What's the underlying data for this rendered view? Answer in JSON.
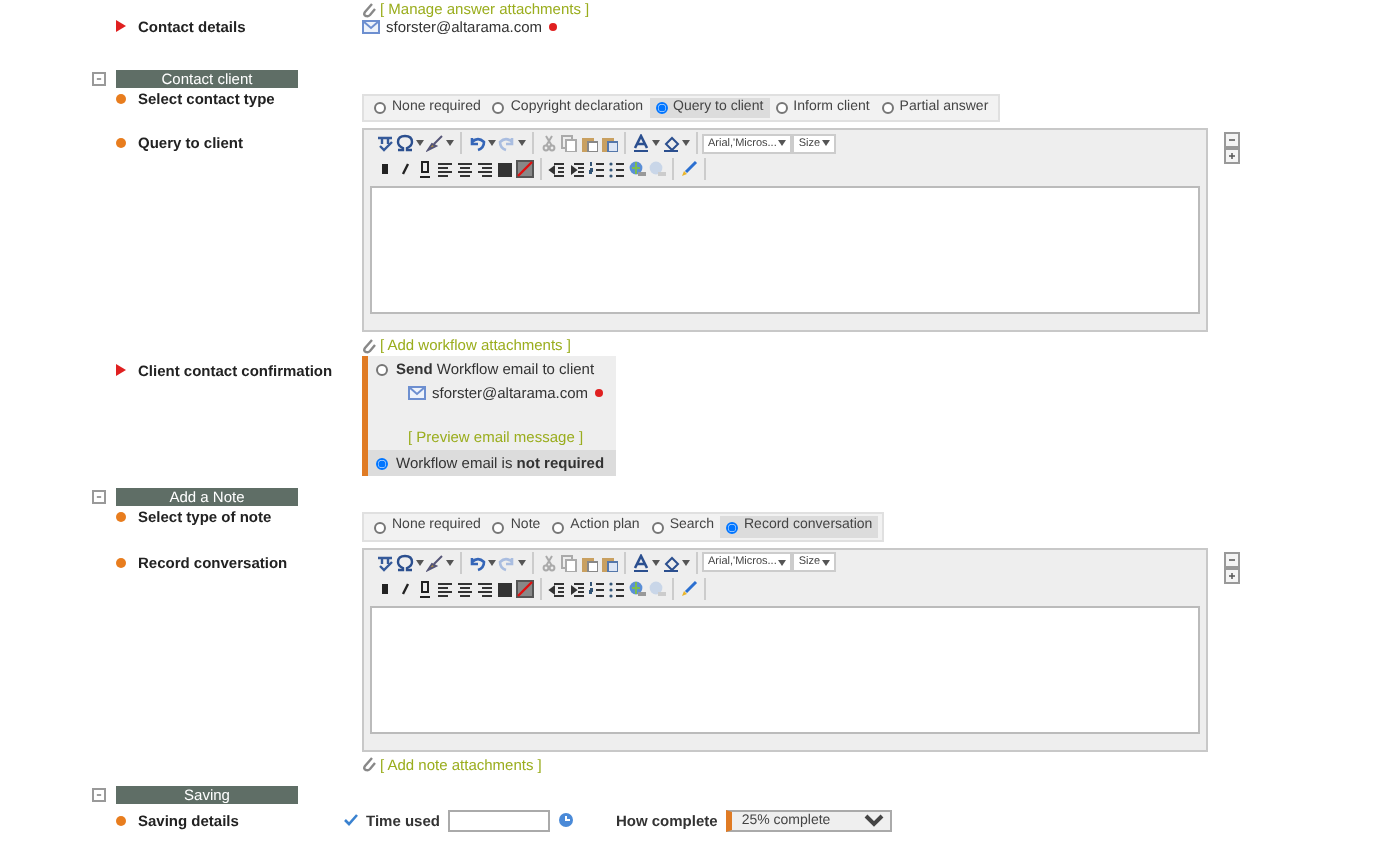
{
  "answer_attachments_link": "[ Manage answer attachments ]",
  "contact_details": {
    "label": "Contact details",
    "mandatory": true,
    "email": "sforster@altarama.com",
    "required": true
  },
  "sections": [
    {
      "title": "Contact client",
      "fields": [
        {
          "kind": "radio_group",
          "label": "Select contact type",
          "mandatory": false,
          "options": [
            {
              "label": "None required",
              "selected": false
            },
            {
              "label": "Copyright declaration",
              "selected": false
            },
            {
              "label": "Query to client",
              "selected": true
            },
            {
              "label": "Inform client",
              "selected": false
            },
            {
              "label": "Partial answer",
              "selected": false
            }
          ]
        },
        {
          "kind": "editor",
          "label": "Query to client",
          "mandatory": false,
          "font": "Arial,'Micros...",
          "size": "Size",
          "attachments_link": "[ Add workflow attachments ]"
        },
        {
          "kind": "confirmation",
          "label": "Client contact confirmation",
          "mandatory": true,
          "options": [
            {
              "text": "**Send** Workflow email to client",
              "email": "sforster@altarama.com",
              "required": true,
              "link": "[ Preview email message ]",
              "selected": false
            },
            {
              "text": "Workflow email is **not required**",
              "selected": true
            }
          ]
        }
      ]
    },
    {
      "title": "Add a Note",
      "fields": [
        {
          "kind": "radio_group",
          "label": "Select type of note",
          "mandatory": false,
          "options": [
            {
              "label": "None required",
              "selected": false
            },
            {
              "label": "Note",
              "selected": false
            },
            {
              "label": "Action plan",
              "selected": false
            },
            {
              "label": "Search",
              "selected": false
            },
            {
              "label": "Record conversation",
              "selected": true
            }
          ]
        },
        {
          "kind": "editor",
          "label": "Record conversation",
          "mandatory": false,
          "font": "Arial,'Micros...",
          "size": "Size",
          "attachments_link": "[ Add note attachments ]"
        }
      ]
    },
    {
      "title": "Saving",
      "fields": [
        {
          "kind": "saving",
          "label": "Saving details",
          "mandatory": false,
          "time_label": "Time used",
          "complete_label": "How complete",
          "complete_value": "25% complete"
        }
      ]
    }
  ]
}
